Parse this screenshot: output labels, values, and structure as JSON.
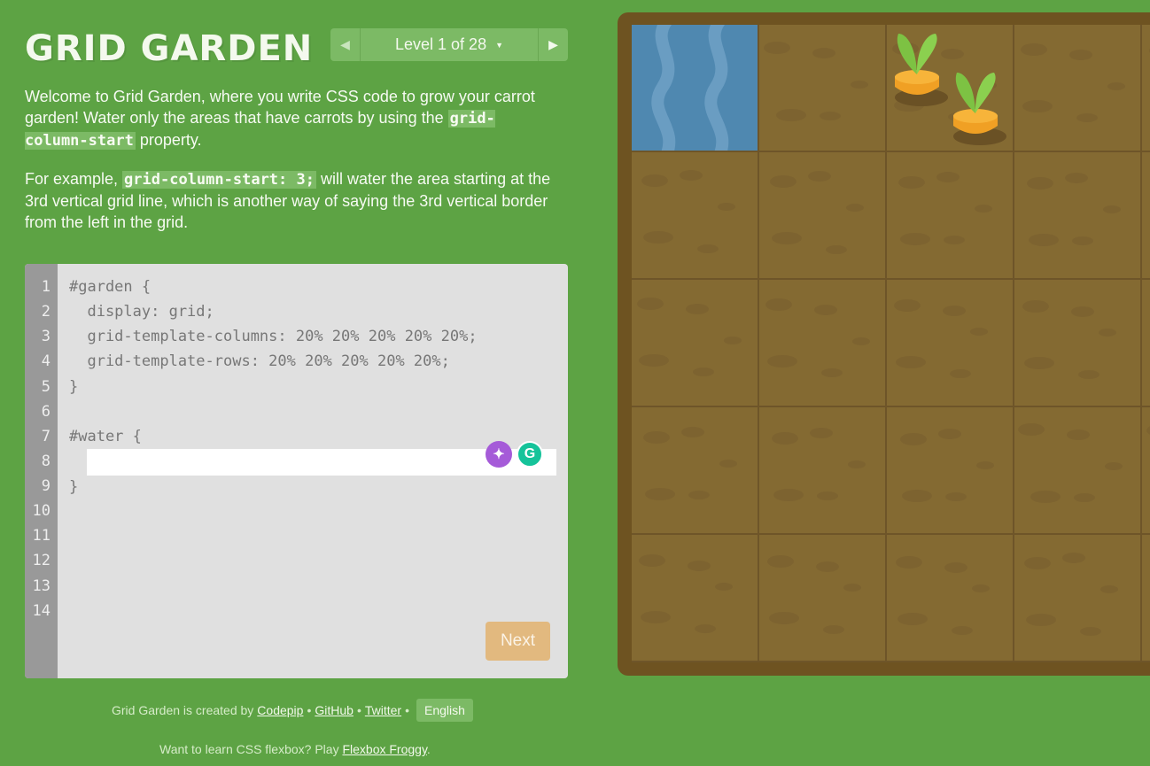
{
  "title": "GRID GARDEN",
  "level": {
    "label": "Level 1 of 28",
    "current": 1,
    "total": 28
  },
  "instructions": {
    "p1_before": "Welcome to Grid Garden, where you write CSS code to grow your carrot garden! Water only the areas that have carrots by using the ",
    "p1_code": "grid-column-start",
    "p1_after": " property.",
    "p2_before": "For example, ",
    "p2_code": "grid-column-start: 3;",
    "p2_after": " will water the area starting at the 3rd vertical grid line, which is another way of saying the 3rd vertical border from the left in the grid."
  },
  "editor": {
    "line_numbers": [
      "1",
      "2",
      "3",
      "4",
      "5",
      "6",
      "7",
      "8",
      "9",
      "10",
      "11",
      "12",
      "13",
      "14"
    ],
    "lines": {
      "l1": "#garden {",
      "l2": "  display: grid;",
      "l3": "  grid-template-columns: 20% 20% 20% 20% 20%;",
      "l4": "  grid-template-rows: 20% 20% 20% 20% 20%;",
      "l5": "}",
      "l7": "#water {",
      "l9": "}"
    },
    "input_value": "",
    "next_label": "Next"
  },
  "footer": {
    "credit_prefix": "Grid Garden is created by",
    "codepip": "Codepip",
    "sep": "•",
    "github": "GitHub",
    "twitter": "Twitter",
    "language": "English",
    "promo_prefix": "Want to learn CSS flexbox? Play",
    "promo_link": "Flexbox Froggy",
    "promo_suffix": "."
  },
  "garden": {
    "columns": 5,
    "rows": 5,
    "water_cell": {
      "column": 1,
      "row": 1
    },
    "carrot_cell": {
      "column": 3,
      "row": 1
    },
    "carrot_count": 2
  },
  "colors": {
    "background": "#5da344",
    "soil": "#846a32",
    "water": "#4f88b0",
    "carrot": "#f5a623",
    "leaf": "#7dc243",
    "next_button": "#e2b97f"
  }
}
